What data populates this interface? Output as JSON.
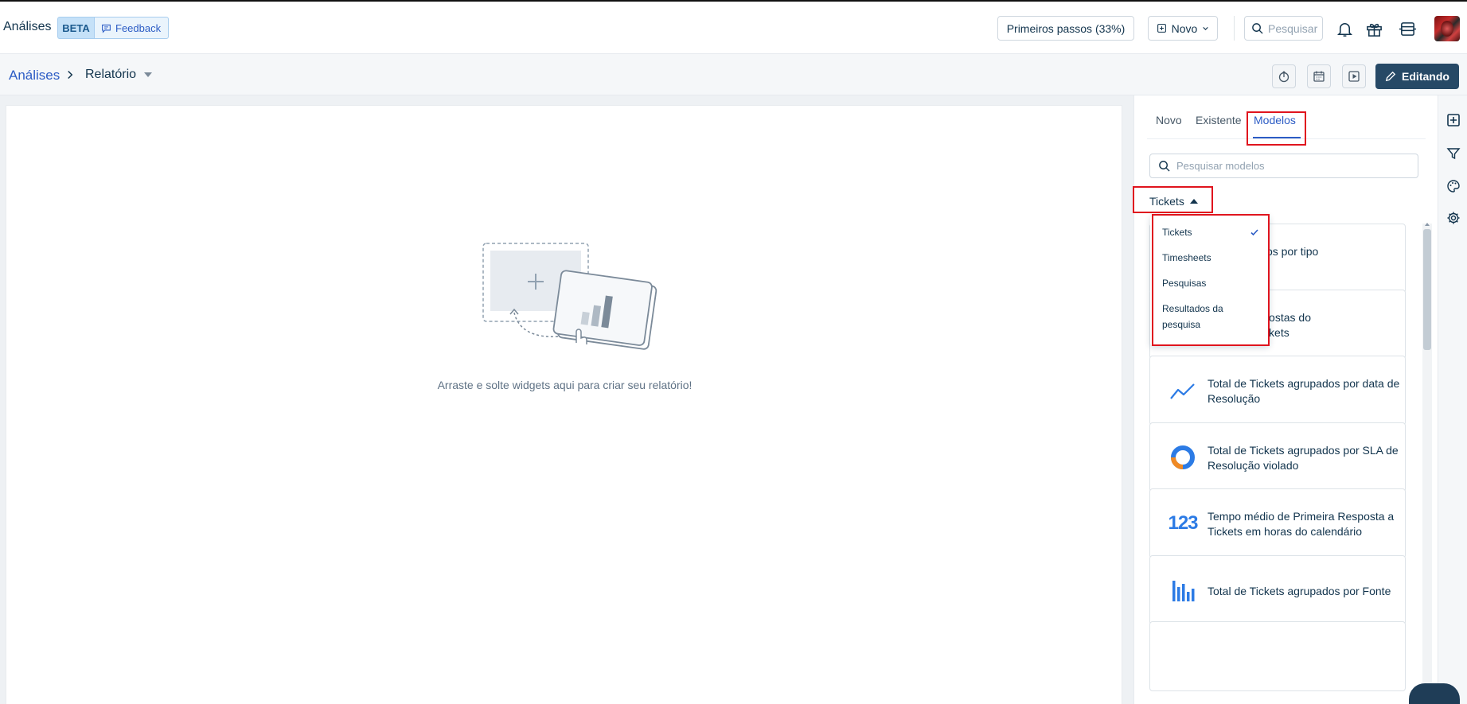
{
  "header": {
    "app_title": "Análises",
    "beta_label": "BETA",
    "feedback_label": "Feedback",
    "primeiros_passos_label": "Primeiros passos (33%)",
    "novo_label": "Novo",
    "search_placeholder": "Pesquisar"
  },
  "subheader": {
    "breadcrumb_root": "Análises",
    "breadcrumb_current": "Relatório",
    "edit_label": "Editando"
  },
  "canvas": {
    "empty_message": "Arraste e solte widgets aqui para criar seu relatório!"
  },
  "panel": {
    "tabs": [
      {
        "label": "Novo"
      },
      {
        "label": "Existente"
      },
      {
        "label": "Modelos"
      }
    ],
    "active_tab": "Modelos",
    "search_placeholder": "Pesquisar modelos",
    "category_selected": "Tickets",
    "category_options": [
      {
        "label": "Tickets",
        "selected": true
      },
      {
        "label": "Timesheets",
        "selected": false
      },
      {
        "label": "Pesquisas",
        "selected": false
      },
      {
        "label": "Resultados da pesquisa",
        "selected": false
      }
    ],
    "templates": [
      {
        "icon": "bar-chart-icon",
        "title": "Total de Tickets agrupados por tipo de Ticket",
        "visible_title": "ets agrupados por tipo\no"
      },
      {
        "icon": "bar-chart-icon",
        "title": "Contagem média de respostas do Cliente a Tickets",
        "visible_title": "édia de respostas do\nCliente a Tickets"
      },
      {
        "icon": "line-chart-icon",
        "title": "Total de Tickets agrupados por data de Resolução"
      },
      {
        "icon": "donut-chart-icon",
        "title": "Total de Tickets agrupados por SLA de Resolução violado"
      },
      {
        "icon": "number-icon",
        "icon_text": "123",
        "title": "Tempo médio de Primeira Resposta a Tickets em horas do calendário"
      },
      {
        "icon": "column-chart-icon",
        "title": "Total de Tickets agrupados por Fonte"
      }
    ]
  },
  "colors": {
    "accent": "#2c5cc5",
    "primary_button": "#264966",
    "highlight": "#e0141e",
    "chart_blue": "#2c7be5",
    "chart_orange": "#f08a24"
  }
}
